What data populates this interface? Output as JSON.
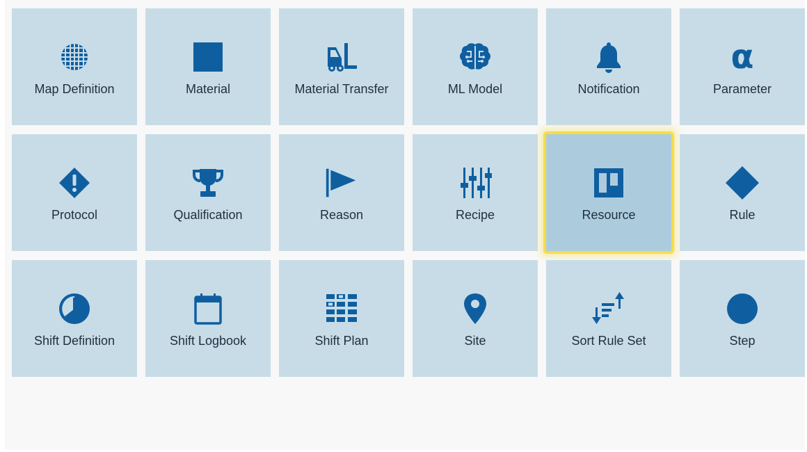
{
  "accent_color": "#0f5fa0",
  "tile_color": "#c8dce7",
  "selected_tile_color": "#acccde",
  "highlight_color": "#f5dd4a",
  "selected": "Resource",
  "tiles": [
    {
      "label": "Map Definition",
      "icon": "map-grid-icon"
    },
    {
      "label": "Material",
      "icon": "square-icon"
    },
    {
      "label": "Material Transfer",
      "icon": "forklift-icon"
    },
    {
      "label": "ML Model",
      "icon": "brain-icon"
    },
    {
      "label": "Notification",
      "icon": "bell-icon"
    },
    {
      "label": "Parameter",
      "icon": "alpha-icon"
    },
    {
      "label": "Protocol",
      "icon": "diamond-exclamation-icon"
    },
    {
      "label": "Qualification",
      "icon": "trophy-icon"
    },
    {
      "label": "Reason",
      "icon": "flag-icon"
    },
    {
      "label": "Recipe",
      "icon": "sliders-icon"
    },
    {
      "label": "Resource",
      "icon": "kanban-board-icon"
    },
    {
      "label": "Rule",
      "icon": "diamond-icon"
    },
    {
      "label": "Shift Definition",
      "icon": "clock-icon"
    },
    {
      "label": "Shift Logbook",
      "icon": "calendar-icon"
    },
    {
      "label": "Shift Plan",
      "icon": "grid-plan-icon"
    },
    {
      "label": "Site",
      "icon": "map-pin-icon"
    },
    {
      "label": "Sort Rule Set",
      "icon": "sort-list-icon"
    },
    {
      "label": "Step",
      "icon": "circle-icon"
    }
  ]
}
